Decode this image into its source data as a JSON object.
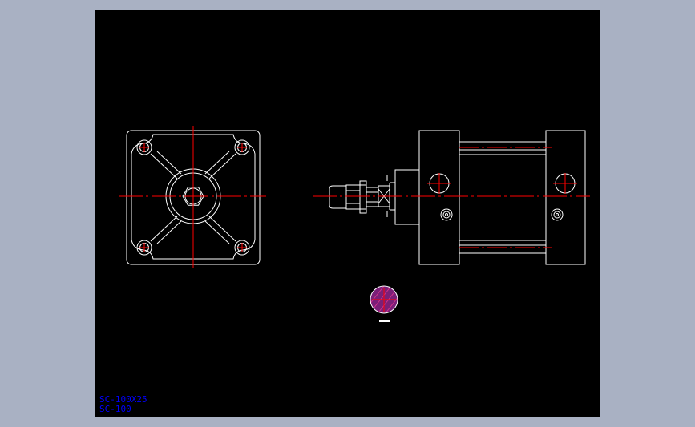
{
  "drawing": {
    "background_color": "#000000",
    "frame_color": "#a9b1c3",
    "outline_color": "#ffffff",
    "centerline_color": "#ff0000",
    "hatch_fill_color": "#7a1f78",
    "label_color": "#0000ff",
    "labels": {
      "model": "SC-100X25",
      "size": "SC-100"
    }
  }
}
